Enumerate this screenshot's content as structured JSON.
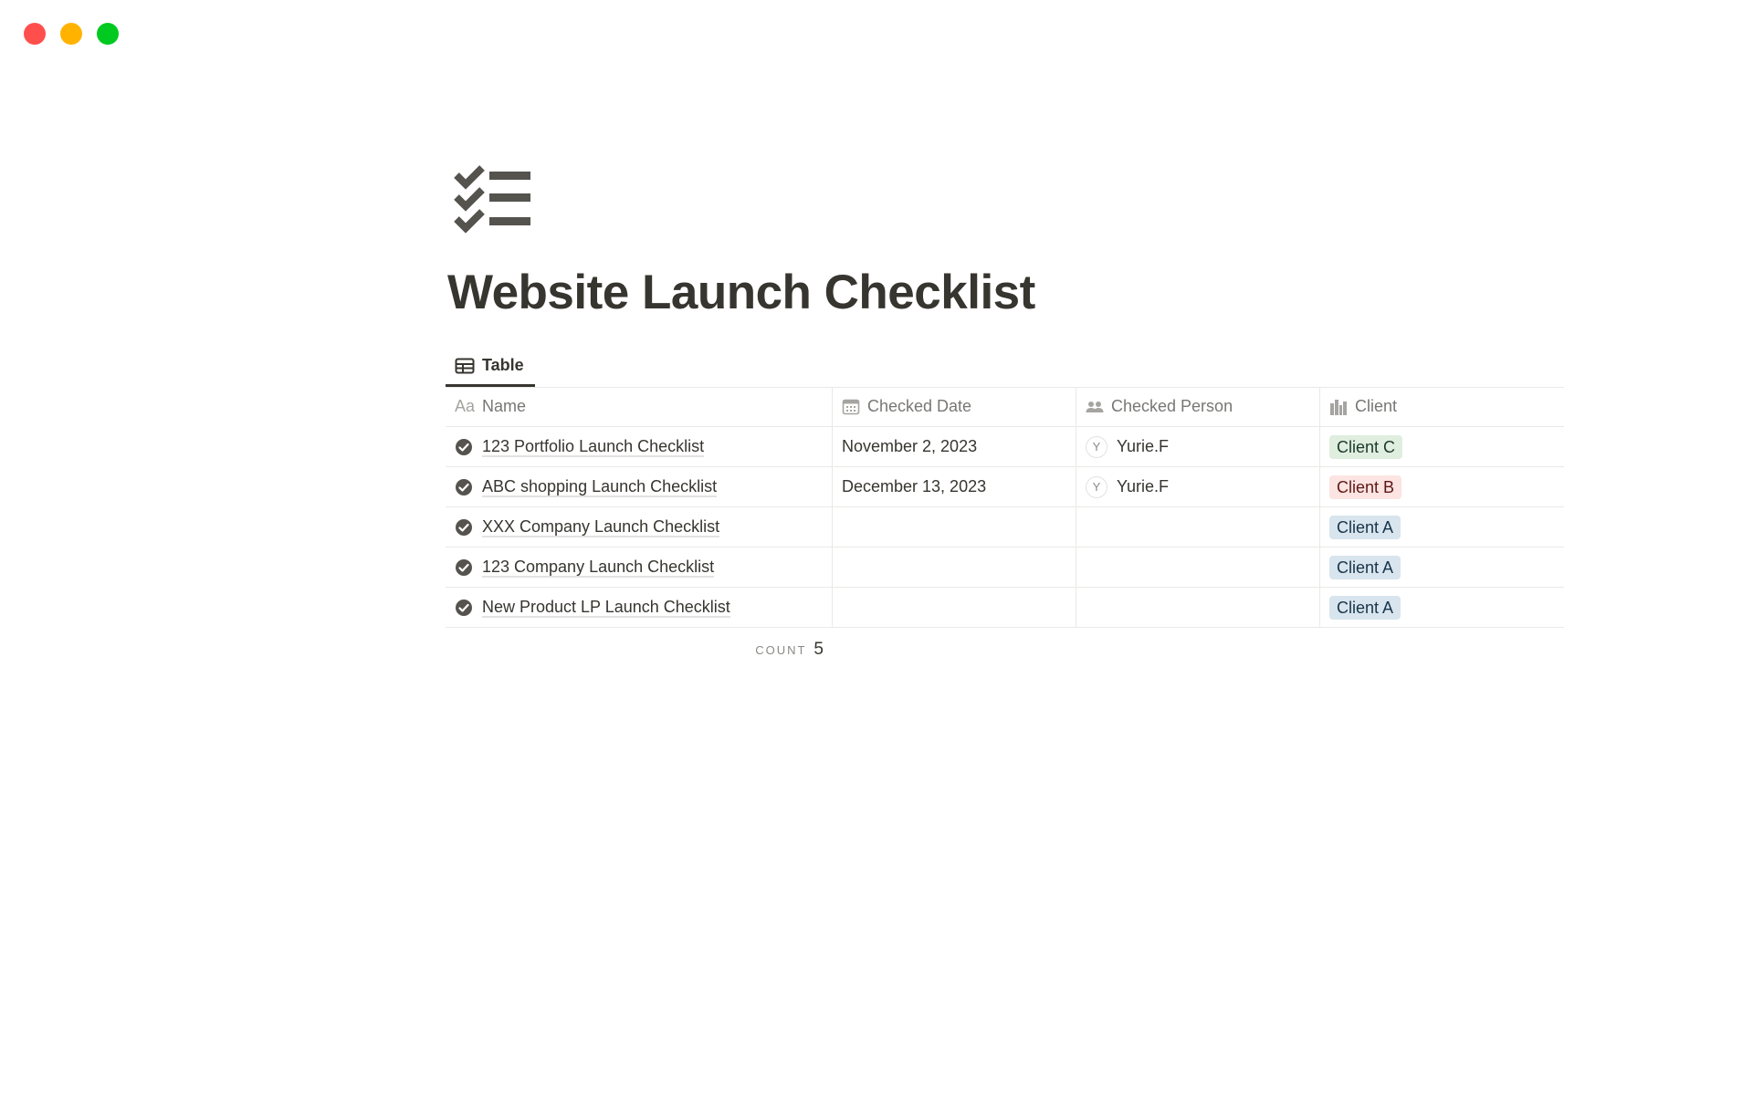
{
  "window": {
    "controls": [
      "close",
      "minimize",
      "maximize"
    ]
  },
  "page": {
    "icon": "checklist-icon",
    "title": "Website Launch Checklist"
  },
  "views": {
    "tabs": [
      {
        "label": "Table",
        "icon": "table-icon",
        "active": true
      }
    ]
  },
  "table": {
    "columns": [
      {
        "label": "Name",
        "icon": "text-property-icon",
        "icon_text": "Aa"
      },
      {
        "label": "Checked Date",
        "icon": "calendar-icon"
      },
      {
        "label": "Checked Person",
        "icon": "people-icon"
      },
      {
        "label": "Client",
        "icon": "building-icon"
      }
    ],
    "rows": [
      {
        "name": "123 Portfolio Launch Checklist",
        "date": "November 2, 2023",
        "person": "Yurie.F",
        "person_initial": "Y",
        "client": "Client C"
      },
      {
        "name": "ABC shopping Launch Checklist",
        "date": "December 13, 2023",
        "person": "Yurie.F",
        "person_initial": "Y",
        "client": "Client B"
      },
      {
        "name": "XXX Company Launch Checklist",
        "date": "",
        "person": "",
        "person_initial": "",
        "client": "Client A"
      },
      {
        "name": "123 Company Launch Checklist",
        "date": "",
        "person": "",
        "person_initial": "",
        "client": "Client A"
      },
      {
        "name": "New Product LP Launch Checklist",
        "date": "",
        "person": "",
        "person_initial": "",
        "client": "Client A"
      }
    ],
    "footer": {
      "count_label": "COUNT",
      "count_value": "5"
    }
  },
  "colors": {
    "client_c_bg": "#dfeedf",
    "client_c_fg": "#1c3829",
    "client_b_bg": "#fbe4e1",
    "client_b_fg": "#5d1715",
    "client_a_bg": "#d8e5ee",
    "client_a_fg": "#183347"
  }
}
